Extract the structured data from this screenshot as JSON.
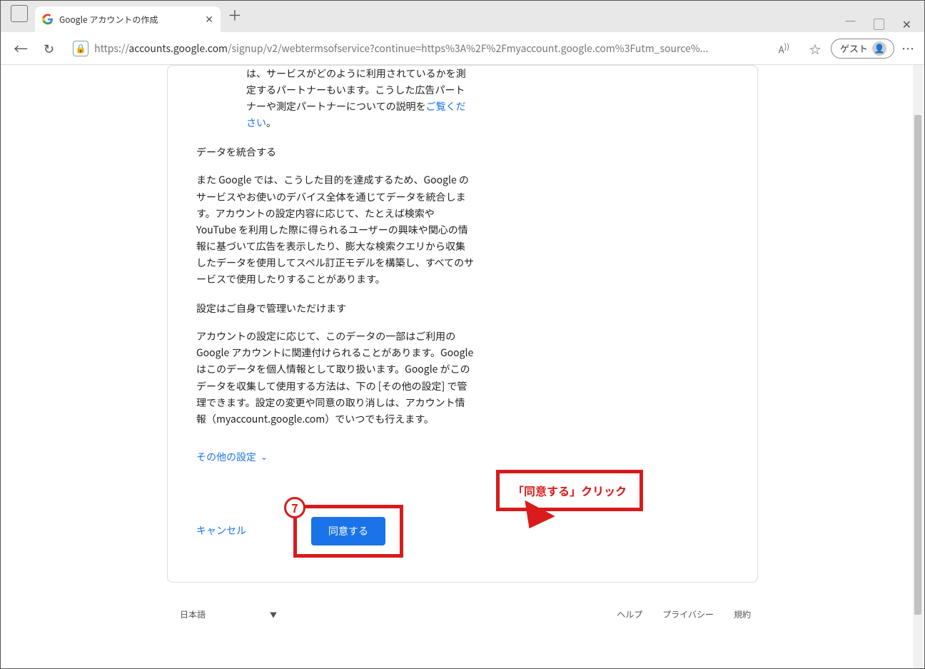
{
  "browser": {
    "tab_title": "Google アカウントの作成",
    "url_prefix": "https://",
    "url_host": "accounts.google.com",
    "url_path": "/signup/v2/webtermsofservice?continue=https%3A%2F%2Fmyaccount.google.com%3Futm_source%...",
    "guest_label": "ゲスト"
  },
  "content": {
    "partner_text_1": "は、サービスがどのように利用されているかを測定するパートナーもいます。こうした広告パートナーや測定パートナーについての説明を",
    "partner_link": "ご覧ください",
    "partner_text_2": "。",
    "section2_heading": "データを統合する",
    "section2_body": "また Google では、こうした目的を達成するため、Google のサービスやお使いのデバイス全体を通じてデータを統合します。アカウントの設定内容に応じて、たとえば検索や YouTube を利用した際に得られるユーザーの興味や関心の情報に基づいて広告を表示したり、膨大な検索クエリから収集したデータを使用してスペル訂正モデルを構築し、すべてのサービスで使用したりすることがあります。",
    "section3_heading": "設定はご自身で管理いただけます",
    "section3_body": "アカウントの設定に応じて、このデータの一部はご利用の Google アカウントに関連付けられることがあります。Google はこのデータを個人情報として取り扱います。Google がこのデータを収集して使用する方法は、下の [その他の設定] で管理できます。設定の変更や同意の取り消しは、アカウント情報（myaccount.google.com）でいつでも行えます。",
    "more_settings": "その他の設定",
    "cancel": "キャンセル",
    "agree": "同意する",
    "step_number": "7",
    "callout_text": "「同意する」クリック"
  },
  "footer": {
    "language": "日本語",
    "help": "ヘルプ",
    "privacy": "プライバシー",
    "terms": "規約"
  }
}
